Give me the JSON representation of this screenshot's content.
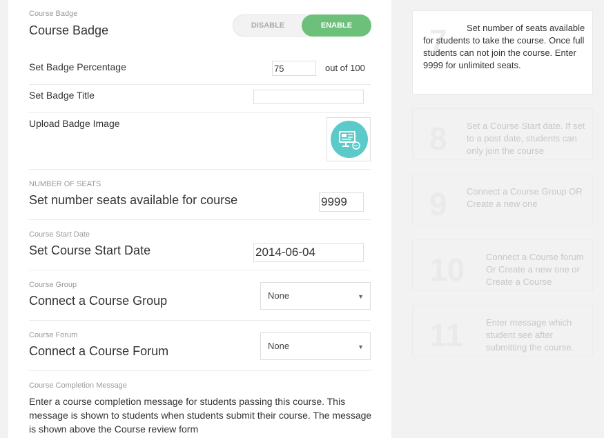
{
  "badge": {
    "small_label": "Course Badge",
    "title": "Course Badge",
    "toggle_off": "DISABLE",
    "toggle_on": "ENABLE",
    "percentage_label": "Set Badge Percentage",
    "percentage_value": "75",
    "percentage_suffix": "out of 100",
    "title_label": "Set Badge Title",
    "title_value": "",
    "image_label": "Upload Badge Image",
    "image_icon": "badge-image-icon"
  },
  "seats": {
    "small_label": "NUMBER OF SEATS",
    "title": "Set number seats available for course",
    "value": "9999"
  },
  "start_date": {
    "small_label": "Course Start Date",
    "title": "Set Course Start Date",
    "value": "2014-06-04"
  },
  "group": {
    "small_label": "Course Group",
    "title": "Connect a Course Group",
    "selected": "None"
  },
  "forum": {
    "small_label": "Course Forum",
    "title": "Connect a Course Forum",
    "selected": "None"
  },
  "completion": {
    "small_label": "Course Completion Message",
    "text": "Enter a course completion message for students passing this course. This message is shown to students when students submit their course. The message is shown above the Course review form"
  },
  "steps": [
    {
      "number": "7",
      "text": "Set number of seats available for students to take the course. Once full students can not join the course. Enter 9999 for unlimited seats."
    },
    {
      "number": "8",
      "text": "Set a Course Start date. If set to a post date, students can only join the course"
    },
    {
      "number": "9",
      "text": "Connect a Course Group OR Create a new one"
    },
    {
      "number": "10",
      "text": "Connect a Course forum Or Create a new one or Create a Course"
    },
    {
      "number": "11",
      "text": "Enter message which student see after submitting the course."
    }
  ],
  "colors": {
    "accent_green": "#6dc07a",
    "badge_teal": "#5ccac9"
  }
}
